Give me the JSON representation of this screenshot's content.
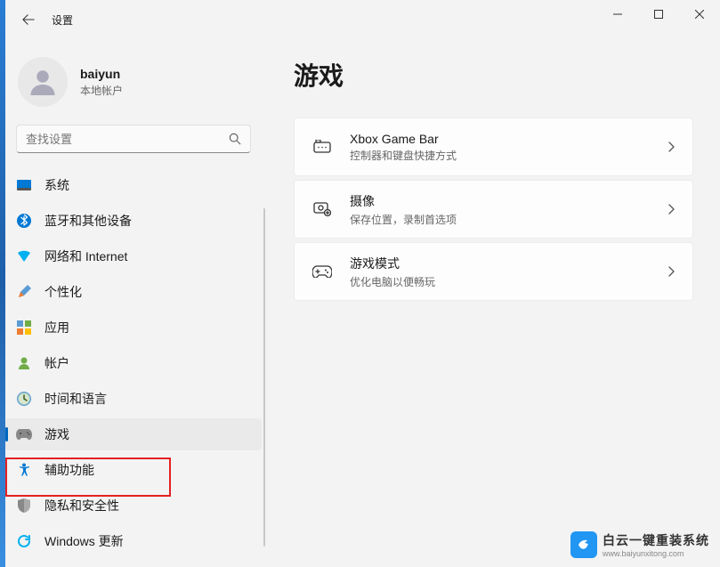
{
  "window": {
    "title": "设置"
  },
  "user": {
    "name": "baiyun",
    "account_type": "本地帐户"
  },
  "search": {
    "placeholder": "查找设置"
  },
  "sidebar": {
    "items": [
      {
        "label": "系统",
        "icon": "system"
      },
      {
        "label": "蓝牙和其他设备",
        "icon": "bluetooth"
      },
      {
        "label": "网络和 Internet",
        "icon": "network"
      },
      {
        "label": "个性化",
        "icon": "personalize"
      },
      {
        "label": "应用",
        "icon": "apps"
      },
      {
        "label": "帐户",
        "icon": "accounts"
      },
      {
        "label": "时间和语言",
        "icon": "time"
      },
      {
        "label": "游戏",
        "icon": "gaming"
      },
      {
        "label": "辅助功能",
        "icon": "accessibility"
      },
      {
        "label": "隐私和安全性",
        "icon": "privacy"
      },
      {
        "label": "Windows 更新",
        "icon": "update"
      }
    ],
    "active_index": 7
  },
  "page": {
    "title": "游戏"
  },
  "cards": [
    {
      "title": "Xbox Game Bar",
      "subtitle": "控制器和键盘快捷方式",
      "icon": "gamebar"
    },
    {
      "title": "摄像",
      "subtitle": "保存位置，录制首选项",
      "icon": "capture"
    },
    {
      "title": "游戏模式",
      "subtitle": "优化电脑以便畅玩",
      "icon": "gamemode"
    }
  ],
  "watermark": {
    "main": "白云一键重装系统",
    "sub": "www.baiyunxitong.com"
  }
}
